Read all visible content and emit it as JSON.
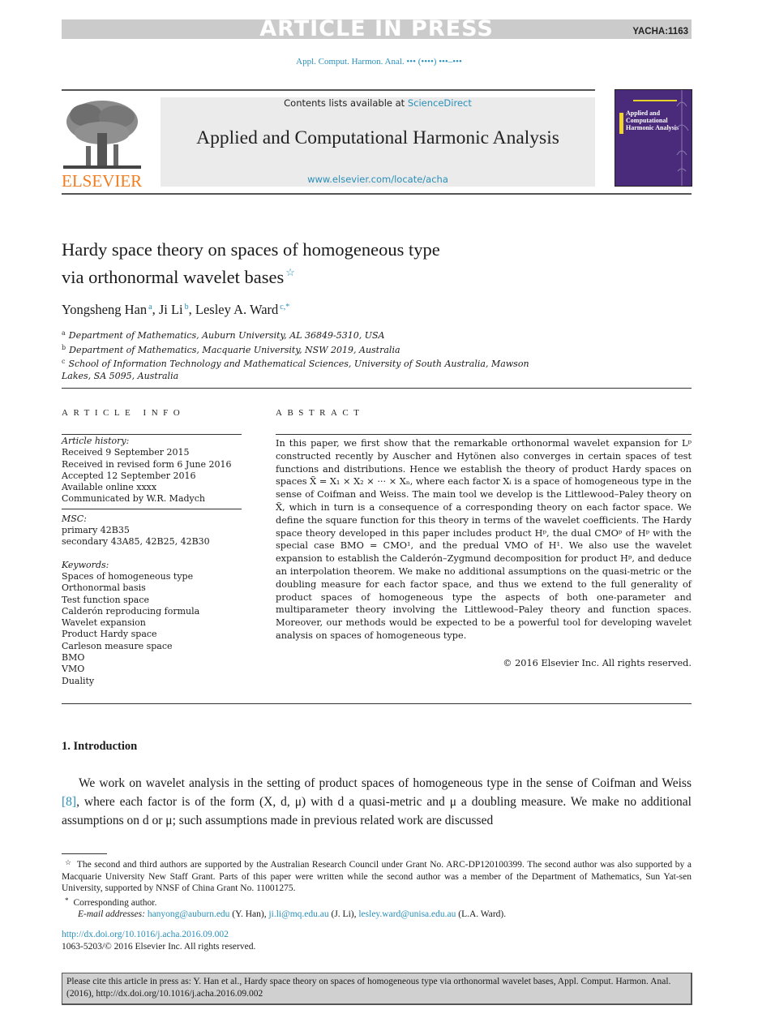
{
  "banner": {
    "status": "ARTICLE IN PRESS",
    "code": "YACHA:1163",
    "journal_ref": "Appl. Comput. Harmon. Anal. ••• (••••) •••–•••"
  },
  "masthead": {
    "publisher_logo": "ELSEVIER",
    "contents_prefix": "Contents lists available at ",
    "contents_link": "ScienceDirect",
    "journal_name": "Applied and Computational Harmonic Analysis",
    "journal_url": "www.elsevier.com/locate/acha",
    "cover_title": "Applied and Computational Harmonic Analysis"
  },
  "article": {
    "title_line1": "Hardy space theory on spaces of homogeneous type",
    "title_line2": "via orthonormal wavelet bases",
    "title_note_mark": "☆",
    "authors": [
      {
        "name": "Yongsheng Han",
        "mark": "a"
      },
      {
        "name": "Ji Li",
        "mark": "b"
      },
      {
        "name": "Lesley A. Ward",
        "mark": "c,*"
      }
    ],
    "affiliations": [
      {
        "mark": "a",
        "text": "Department of Mathematics, Auburn University, AL 36849-5310, USA"
      },
      {
        "mark": "b",
        "text": "Department of Mathematics, Macquarie University, NSW 2019, Australia"
      },
      {
        "mark": "c",
        "text": "School of Information Technology and Mathematical Sciences, University of South Australia, Mawson Lakes, SA 5095, Australia"
      }
    ]
  },
  "article_info": {
    "heading": "ARTICLE INFO",
    "history_label": "Article history:",
    "history": [
      "Received 9 September 2015",
      "Received in revised form 6 June 2016",
      "Accepted 12 September 2016",
      "Available online xxxx",
      "Communicated by W.R. Madych"
    ],
    "msc_label": "MSC:",
    "msc": [
      "primary 42B35",
      "secondary 43A85, 42B25, 42B30"
    ],
    "keywords_label": "Keywords:",
    "keywords": [
      "Spaces of homogeneous type",
      "Orthonormal basis",
      "Test function space",
      "Calderón reproducing formula",
      "Wavelet expansion",
      "Product Hardy space",
      "Carleson measure space",
      "BMO",
      "VMO",
      "Duality"
    ]
  },
  "abstract": {
    "heading": "ABSTRACT",
    "text": "In this paper, we first show that the remarkable orthonormal wavelet expansion for Lᵖ constructed recently by Auscher and Hytönen also converges in certain spaces of test functions and distributions. Hence we establish the theory of product Hardy spaces on spaces X̃ = X₁ × X₂ × ··· × Xₙ, where each factor Xᵢ is a space of homogeneous type in the sense of Coifman and Weiss. The main tool we develop is the Littlewood–Paley theory on X̃, which in turn is a consequence of a corresponding theory on each factor space. We define the square function for this theory in terms of the wavelet coefficients. The Hardy space theory developed in this paper includes product Hᵖ, the dual CMOᵖ of Hᵖ with the special case BMO = CMO¹, and the predual VMO of H¹. We also use the wavelet expansion to establish the Calderón–Zygmund decomposition for product Hᵖ, and deduce an interpolation theorem. We make no additional assumptions on the quasi-metric or the doubling measure for each factor space, and thus we extend to the full generality of product spaces of homogeneous type the aspects of both one-parameter and multiparameter theory involving the Littlewood–Paley theory and function spaces. Moreover, our methods would be expected to be a powerful tool for developing wavelet analysis on spaces of homogeneous type.",
    "copyright": "© 2016 Elsevier Inc. All rights reserved."
  },
  "introduction": {
    "heading": "1.  Introduction",
    "text_before_ref": "We work on wavelet analysis in the setting of product spaces of homogeneous type in the sense of Coifman and Weiss ",
    "ref": "[8]",
    "text_after_ref": ", where each factor is of the form (X, d, μ) with d a quasi-metric and μ a doubling measure. We make no additional assumptions on d or μ; such assumptions made in previous related work are discussed"
  },
  "footnotes": {
    "funding_mark": "☆",
    "funding": "The second and third authors are supported by the Australian Research Council under Grant No. ARC-DP120100399. The second author was also supported by a Macquarie University New Staff Grant. Parts of this paper were written while the second author was a member of the Department of Mathematics, Sun Yat-sen University, supported by NNSF of China Grant No. 11001275.",
    "corresponding_mark": "*",
    "corresponding": "Corresponding author.",
    "email_label": "E-mail addresses:",
    "emails": [
      {
        "address": "hanyong@auburn.edu",
        "who": "(Y. Han)"
      },
      {
        "address": "ji.li@mq.edu.au",
        "who": "(J. Li)"
      },
      {
        "address": "lesley.ward@unisa.edu.au",
        "who": "(L.A. Ward)"
      }
    ],
    "doi": "http://dx.doi.org/10.1016/j.acha.2016.09.002",
    "issn": "1063-5203/© 2016 Elsevier Inc. All rights reserved."
  },
  "cite_box": {
    "text": "Please cite this article in press as: Y. Han et al., Hardy space theory on spaces of homogeneous type via orthonormal wavelet bases, Appl. Comput. Harmon. Anal. (2016), http://dx.doi.org/10.1016/j.acha.2016.09.002"
  },
  "colors": {
    "link": "#2a8fb8",
    "elsevier_orange": "#f07d20",
    "banner_gray": "#cbcbcb",
    "masthead_gray": "#ebebeb",
    "cover_purple": "#4a2a7a"
  }
}
